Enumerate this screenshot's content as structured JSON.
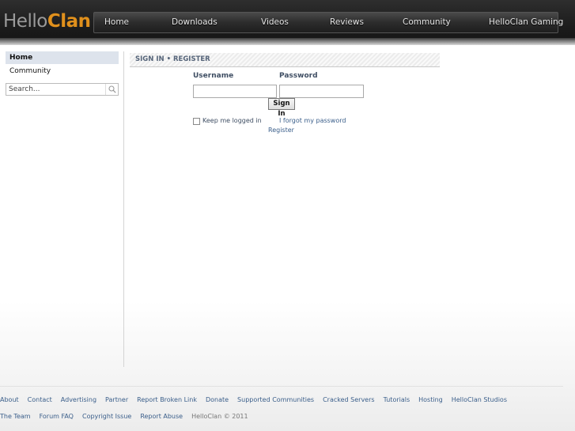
{
  "header": {
    "logo_hello": "Hello",
    "logo_clan": "Clan",
    "nav": [
      {
        "label": "Home"
      },
      {
        "label": "Downloads"
      },
      {
        "label": "Videos"
      },
      {
        "label": "Reviews"
      },
      {
        "label": "Community"
      },
      {
        "label": "HelloClan Gaming"
      }
    ]
  },
  "sidebar": {
    "items": [
      {
        "label": "Home"
      },
      {
        "label": "Community"
      }
    ],
    "search_placeholder": "Search...",
    "search_icon": "magnifier-icon"
  },
  "signin": {
    "title": "SIGN IN • REGISTER",
    "username_label": "Username",
    "password_label": "Password",
    "username_value": "",
    "password_value": "",
    "button_label": "Sign In",
    "keep_logged_in": "Keep me logged in",
    "forgot_password": "I forgot my password",
    "register": "Register"
  },
  "footer": {
    "row1": [
      "About",
      "Contact",
      "Advertising",
      "Partner",
      "Report Broken Link",
      "Donate",
      "Supported Communities",
      "Cracked Servers",
      "Tutorials",
      "Hosting",
      "HelloClan Studios"
    ],
    "row2": [
      "The Team",
      "Forum FAQ",
      "Copyright Issue",
      "Report Abuse"
    ],
    "copyright": "HelloClan © 2011"
  },
  "colors": {
    "brand_orange": "#e0901c",
    "link_blue": "#3a5e8a",
    "header_dark": "#1c1c1c"
  }
}
